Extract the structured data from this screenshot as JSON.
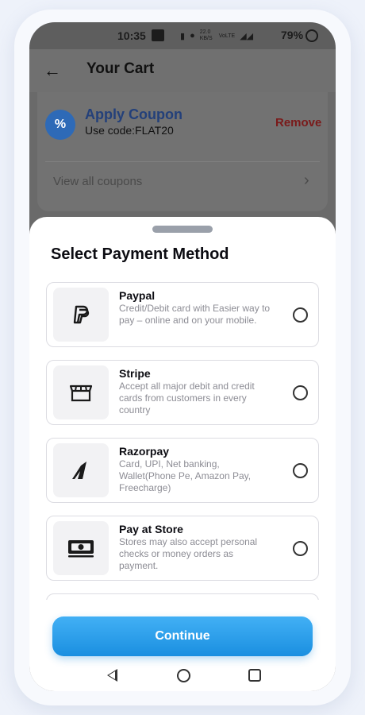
{
  "status_bar": {
    "time": "10:35",
    "data_speed": "22.0 KB/S",
    "network": "VoLTE",
    "battery": "79%"
  },
  "header": {
    "title": "Your Cart",
    "back_icon": "arrow-left-icon"
  },
  "coupon": {
    "title": "Apply Coupon",
    "code_text": "Use code:FLAT20",
    "remove_label": "Remove",
    "view_all_label": "View all coupons",
    "badge_icon": "percent-badge-icon"
  },
  "sheet": {
    "title": "Select Payment Method",
    "options": [
      {
        "name": "Paypal",
        "description": "Credit/Debit card with Easier way to pay – online and on your mobile.",
        "icon": "paypal-icon",
        "selected": false
      },
      {
        "name": "Stripe",
        "description": "Accept all major debit and credit cards from customers in every country",
        "icon": "store-icon",
        "selected": false
      },
      {
        "name": "Razorpay",
        "description": "Card, UPI, Net banking, Wallet(Phone Pe, Amazon Pay, Freecharge)",
        "icon": "razorpay-icon",
        "selected": false
      },
      {
        "name": "Pay at Store",
        "description": "Stores may also accept personal checks or money orders as payment.",
        "icon": "cash-icon",
        "selected": false
      }
    ],
    "continue_label": "Continue"
  },
  "colors": {
    "accent": "#1e96e6",
    "text_dark": "#0c0c12",
    "text_muted": "#8c8c94",
    "remove_red": "#c0392b"
  }
}
